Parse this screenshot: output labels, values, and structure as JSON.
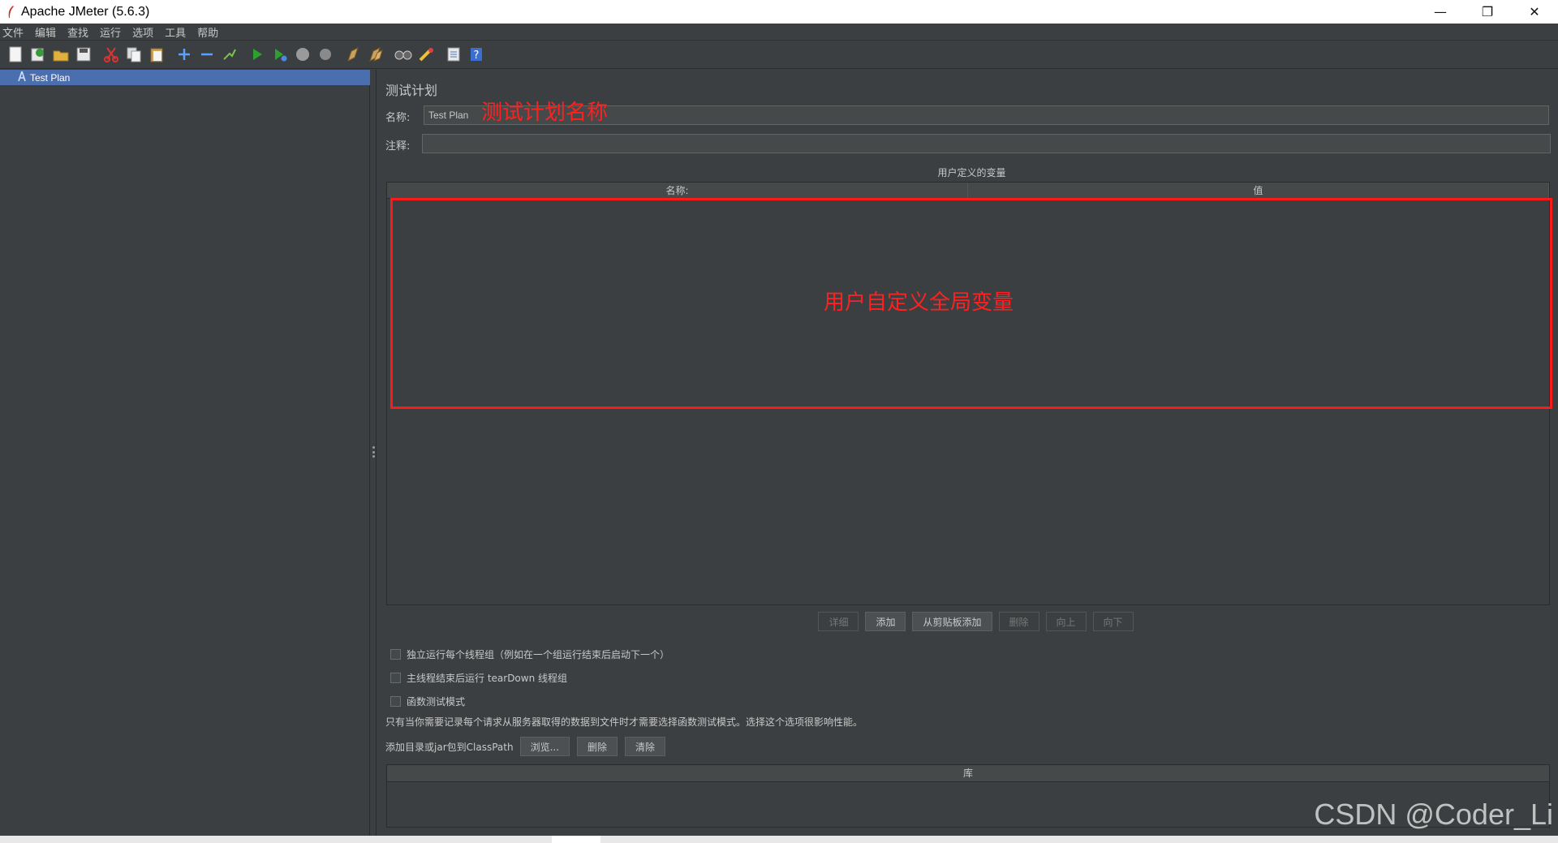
{
  "window": {
    "title": "Apache JMeter (5.6.3)",
    "controls": [
      "—",
      "❐",
      "✕"
    ]
  },
  "menu": [
    "文件",
    "编辑",
    "查找",
    "运行",
    "选项",
    "工具",
    "帮助"
  ],
  "toolbar": {
    "icons": [
      "new-icon",
      "templates-icon",
      "open-icon",
      "save-icon",
      "cut-icon",
      "copy-icon",
      "paste-icon",
      "expand-icon",
      "collapse-icon",
      "toggle-icon",
      "start-icon",
      "start-no-pause-icon",
      "stop-icon",
      "shutdown-icon",
      "clear-icon",
      "clear-all-icon",
      "search-icon",
      "reset-search-icon",
      "function-helper-icon",
      "help-icon"
    ]
  },
  "tree": {
    "items": [
      {
        "label": "Test Plan",
        "selected": true
      }
    ]
  },
  "testplan": {
    "panel_title": "测试计划",
    "name_label": "名称:",
    "name_value": "Test Plan",
    "comment_label": "注释:",
    "comment_value": "",
    "annotation_name": "测试计划名称",
    "variables_title": "用户定义的变量",
    "columns": [
      "名称:",
      "值"
    ],
    "annotation_vars": "用户自定义全局变量",
    "buttons": [
      {
        "label": "详细",
        "enabled": false
      },
      {
        "label": "添加",
        "enabled": true
      },
      {
        "label": "从剪贴板添加",
        "enabled": true
      },
      {
        "label": "删除",
        "enabled": false
      },
      {
        "label": "向上",
        "enabled": false
      },
      {
        "label": "向下",
        "enabled": false
      }
    ],
    "checkboxes": [
      {
        "label": "独立运行每个线程组（例如在一个组运行结束后启动下一个）",
        "checked": false
      },
      {
        "label": "主线程结束后运行 tearDown 线程组",
        "checked": false
      },
      {
        "label": "函数测试模式",
        "checked": false
      }
    ],
    "note": "只有当你需要记录每个请求从服务器取得的数据到文件时才需要选择函数测试模式。选择这个选项很影响性能。",
    "classpath_label": "添加目录或jar包到ClassPath",
    "classpath_buttons": [
      "浏览...",
      "删除",
      "清除"
    ],
    "library_header": "库"
  },
  "watermark": "CSDN @Coder_Li"
}
